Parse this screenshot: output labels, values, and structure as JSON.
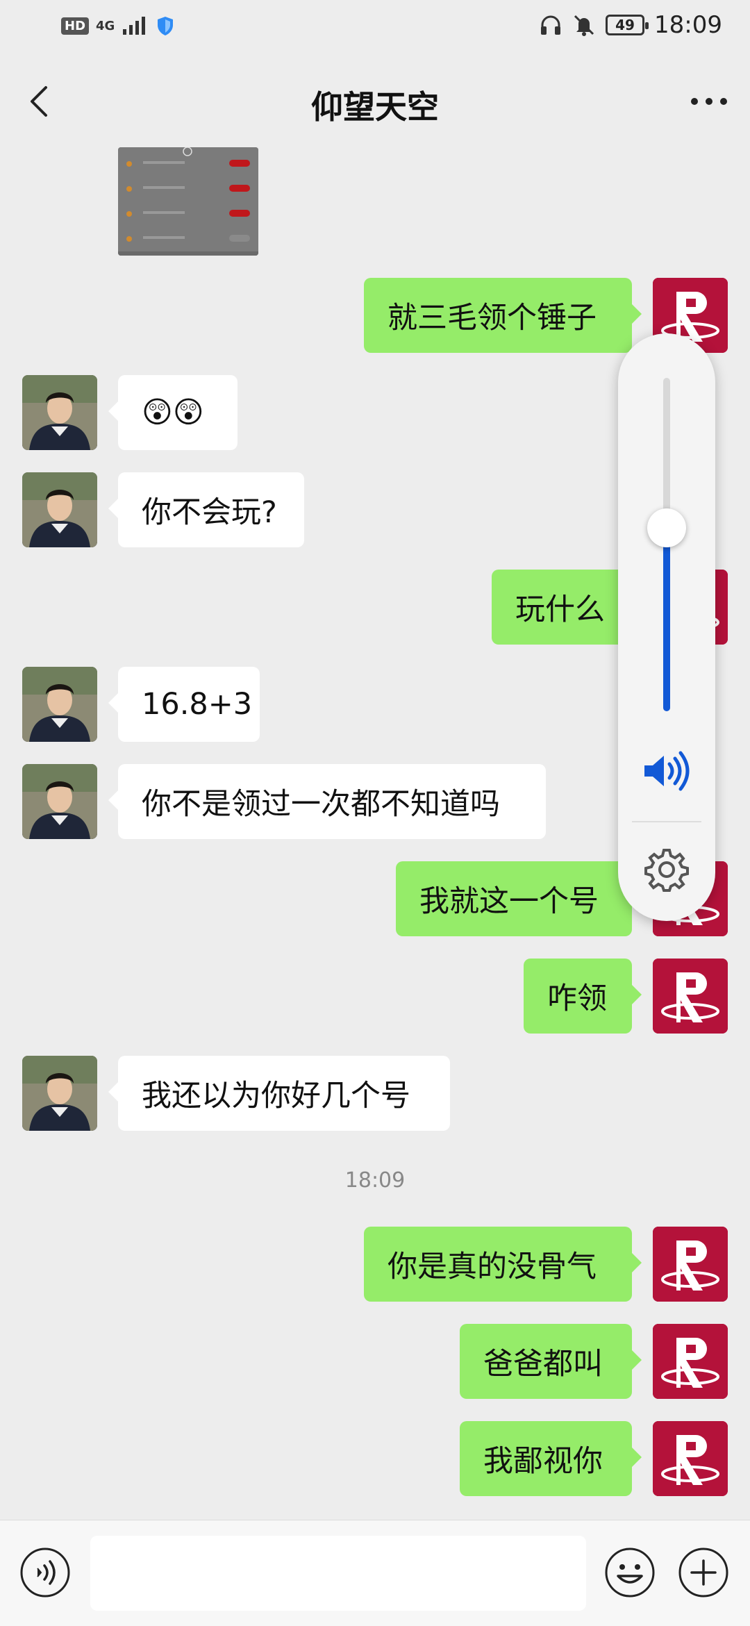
{
  "status_bar": {
    "hd_label": "HD",
    "network_label": "4G",
    "battery_level": "49",
    "time": "18:09"
  },
  "header": {
    "title": "仰望天空"
  },
  "messages": [
    {
      "side": "out",
      "text": "就三毛领个锤子"
    },
    {
      "side": "in",
      "text": "😲😲"
    },
    {
      "side": "in",
      "text": "你不会玩?"
    },
    {
      "side": "out",
      "text": "玩什么"
    },
    {
      "side": "in",
      "text": "16.8+3"
    },
    {
      "side": "in",
      "text": "你不是领过一次都不知道吗"
    },
    {
      "side": "out",
      "text": "我就这一个号"
    },
    {
      "side": "out",
      "text": "咋领"
    },
    {
      "side": "in",
      "text": "我还以为你好几个号"
    },
    {
      "side": "out",
      "text": "你是真的没骨气"
    },
    {
      "side": "out",
      "text": "爸爸都叫"
    },
    {
      "side": "out",
      "text": "我鄙视你"
    }
  ],
  "time_separator": "18:09",
  "volume": {
    "level_fraction": 0.55,
    "accent_color": "#1259d6"
  },
  "input": {
    "placeholder": ""
  },
  "colors": {
    "outgoing_bubble": "#95ec69",
    "incoming_bubble": "#ffffff",
    "background": "#ededed"
  },
  "icons": {
    "back": "chevron-left-icon",
    "more": "more-dots-icon",
    "voice": "voice-icon",
    "emoji": "emoji-icon",
    "plus": "plus-icon",
    "speaker": "speaker-icon",
    "settings": "gear-icon"
  }
}
